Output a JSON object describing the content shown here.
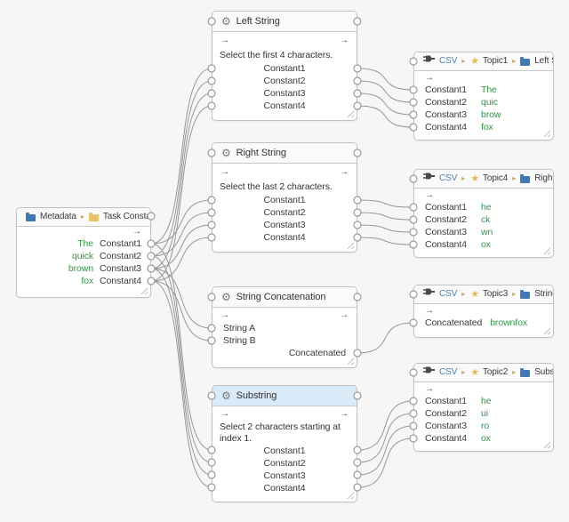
{
  "icons": {
    "gear": "⚙",
    "star": "★",
    "breadcrumb_separator": "▸",
    "flow_arrow": "→",
    "folder_blue": "blue-folder-shape",
    "folder_tan": "tan-folder-shape",
    "plug": "plug-shape"
  },
  "colors": {
    "canvas_bg": "#f6f6f7",
    "node_bg": "#ffffff",
    "node_border": "#c2c2c2",
    "header_bg": "#fafafb",
    "selected_header_bg": "#d9eaf8",
    "value_green": "#2f9a43",
    "csv_blue": "#4d7fb3",
    "star_gold": "#edb84d",
    "folder_blue": "#4179b4",
    "folder_tan": "#e9c36a",
    "wire": "#979797"
  },
  "nodes": {
    "metadata": {
      "crumbs": [
        "Metadata",
        "Task Constants"
      ],
      "rows": [
        {
          "value": "The",
          "label": "Constant1"
        },
        {
          "value": "quick",
          "label": "Constant2"
        },
        {
          "value": "brown",
          "label": "Constant3"
        },
        {
          "value": "fox",
          "label": "Constant4"
        }
      ]
    },
    "left_string": {
      "title": "Left String",
      "description": "Select the first 4 characters.",
      "rows": [
        {
          "label": "Constant1"
        },
        {
          "label": "Constant2"
        },
        {
          "label": "Constant3"
        },
        {
          "label": "Constant4"
        }
      ]
    },
    "right_string": {
      "title": "Right String",
      "description": "Select the last 2 characters.",
      "rows": [
        {
          "label": "Constant1"
        },
        {
          "label": "Constant2"
        },
        {
          "label": "Constant3"
        },
        {
          "label": "Constant4"
        }
      ]
    },
    "string_concatenation": {
      "title": "String Concatenation",
      "inputs": [
        {
          "label": "String A"
        },
        {
          "label": "String B"
        }
      ],
      "output": {
        "label": "Concatenated"
      }
    },
    "substring": {
      "title": "Substring",
      "description": "Select 2 characters starting at index 1.",
      "rows": [
        {
          "label": "Constant1"
        },
        {
          "label": "Constant2"
        },
        {
          "label": "Constant3"
        },
        {
          "label": "Constant4"
        }
      ]
    },
    "topic1": {
      "crumbs": [
        "CSV",
        "Topic1",
        "Left St..."
      ],
      "rows": [
        {
          "label": "Constant1",
          "value": "The"
        },
        {
          "label": "Constant2",
          "value": "quic"
        },
        {
          "label": "Constant3",
          "value": "brow"
        },
        {
          "label": "Constant4",
          "value": "fox"
        }
      ]
    },
    "topic4": {
      "crumbs": [
        "CSV",
        "Topic4",
        "Right..."
      ],
      "rows": [
        {
          "label": "Constant1",
          "value": "he"
        },
        {
          "label": "Constant2",
          "value": "ck"
        },
        {
          "label": "Constant3",
          "value": "wn"
        },
        {
          "label": "Constant4",
          "value": "ox"
        }
      ]
    },
    "topic3": {
      "crumbs": [
        "CSV",
        "Topic3",
        "String..."
      ],
      "rows": [
        {
          "label": "Concatenated",
          "value": "brownfox"
        }
      ]
    },
    "topic2": {
      "crumbs": [
        "CSV",
        "Topic2",
        "Substri..."
      ],
      "rows": [
        {
          "label": "Constant1",
          "value": "he"
        },
        {
          "label": "Constant2",
          "value": "ui"
        },
        {
          "label": "Constant3",
          "value": "ro"
        },
        {
          "label": "Constant4",
          "value": "ox"
        }
      ]
    }
  },
  "connections": [
    [
      "metadata.Constant1",
      "left_string.in.Constant1"
    ],
    [
      "metadata.Constant2",
      "left_string.in.Constant2"
    ],
    [
      "metadata.Constant3",
      "left_string.in.Constant3"
    ],
    [
      "metadata.Constant4",
      "left_string.in.Constant4"
    ],
    [
      "metadata.Constant1",
      "right_string.in.Constant1"
    ],
    [
      "metadata.Constant2",
      "right_string.in.Constant2"
    ],
    [
      "metadata.Constant3",
      "right_string.in.Constant3"
    ],
    [
      "metadata.Constant4",
      "right_string.in.Constant4"
    ],
    [
      "metadata.Constant3",
      "string_concatenation.in.String A"
    ],
    [
      "metadata.Constant4",
      "string_concatenation.in.String B"
    ],
    [
      "metadata.Constant1",
      "substring.in.Constant1"
    ],
    [
      "metadata.Constant2",
      "substring.in.Constant2"
    ],
    [
      "metadata.Constant3",
      "substring.in.Constant3"
    ],
    [
      "metadata.Constant4",
      "substring.in.Constant4"
    ],
    [
      "left_string.out.Constant1",
      "topic1.in.Constant1"
    ],
    [
      "left_string.out.Constant2",
      "topic1.in.Constant2"
    ],
    [
      "left_string.out.Constant3",
      "topic1.in.Constant3"
    ],
    [
      "left_string.out.Constant4",
      "topic1.in.Constant4"
    ],
    [
      "right_string.out.Constant1",
      "topic4.in.Constant1"
    ],
    [
      "right_string.out.Constant2",
      "topic4.in.Constant2"
    ],
    [
      "right_string.out.Constant3",
      "topic4.in.Constant3"
    ],
    [
      "right_string.out.Constant4",
      "topic4.in.Constant4"
    ],
    [
      "string_concatenation.out.Concatenated",
      "topic3.in.Concatenated"
    ],
    [
      "substring.out.Constant1",
      "topic2.in.Constant1"
    ],
    [
      "substring.out.Constant2",
      "topic2.in.Constant2"
    ],
    [
      "substring.out.Constant3",
      "topic2.in.Constant3"
    ],
    [
      "substring.out.Constant4",
      "topic2.in.Constant4"
    ]
  ]
}
